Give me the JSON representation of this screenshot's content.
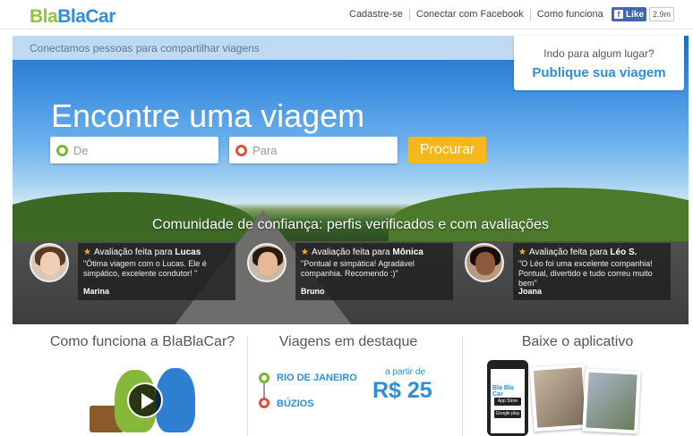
{
  "header": {
    "logo": {
      "part1": "Bla",
      "part2": "Bla",
      "part3": "Car"
    },
    "nav": [
      "Cadastre-se",
      "Conectar com Facebook",
      "Como funciona"
    ],
    "fb_like": "Like",
    "fb_count": "2.9m"
  },
  "hero": {
    "tagline": "Conectamos pessoas para compartilhar viagens",
    "publish_question": "Indo para algum lugar?",
    "publish_link": "Publique sua viagem",
    "title": "Encontre uma viagem",
    "from_placeholder": "De",
    "to_placeholder": "Para",
    "search_button": "Procurar",
    "community": "Comunidade de confiança: perfis verificados e com avaliações",
    "reviews": [
      {
        "prefix": "Avaliação feita para",
        "name": "Lucas",
        "text": "\"Ótima viagem com o Lucas. Ele é simpático, excelente condutor! \"",
        "author": "Marina"
      },
      {
        "prefix": "Avaliação feita para",
        "name": "Mônica",
        "text": "\"Pontual e simpática! Agradável companhia. Recomendo :)\"",
        "author": "Bruno"
      },
      {
        "prefix": "Avaliação feita para",
        "name": "Léo S.",
        "text": "\"O Léo foi uma excelente companhia! Pontual, divertido e tudo correu muito bem\"",
        "author": "Joana"
      }
    ]
  },
  "bottom": {
    "how_title": "Como funciona a BlaBlaCar?",
    "featured_title": "Viagens em destaque",
    "featured": {
      "from": "RIO DE JANEIRO",
      "to": "BÚZIOS",
      "price_from": "a partir de",
      "price": "R$ 25"
    },
    "app_title": "Baixe o aplicativo",
    "app": {
      "logo": "Bla Bla Car",
      "store1": "App Store",
      "store2": "Google play"
    }
  },
  "colors": {
    "green": "#8cc63f",
    "blue": "#2b8fd9",
    "yellow": "#f6b71a",
    "red": "#e04e3a"
  }
}
